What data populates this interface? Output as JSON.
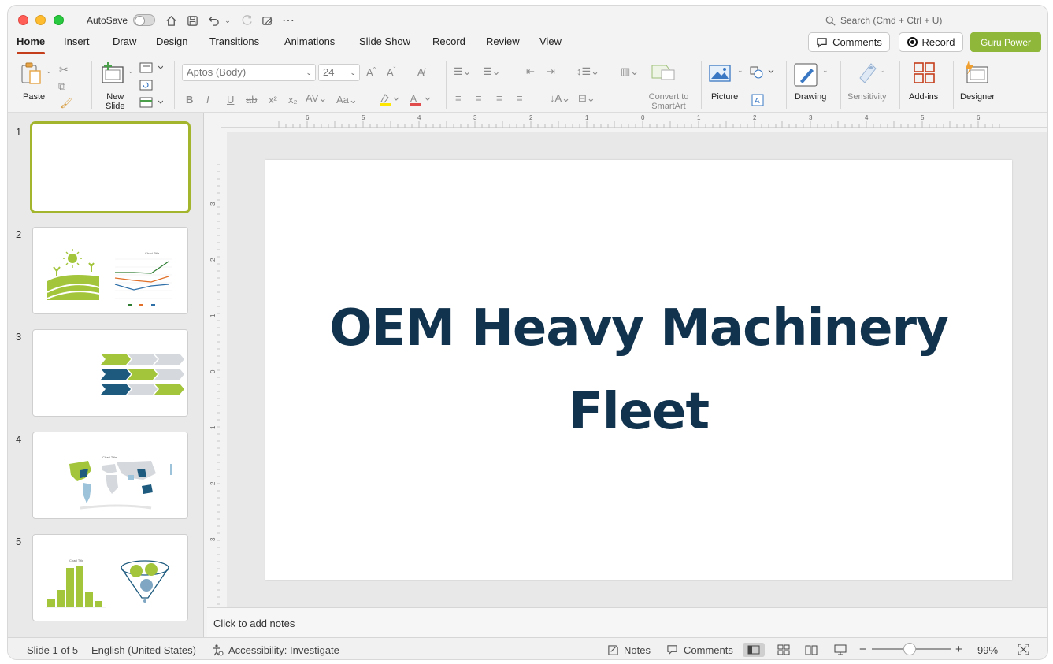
{
  "titlebar": {
    "autosave_label": "AutoSave",
    "search_placeholder": "Search (Cmd + Ctrl + U)"
  },
  "tabs": [
    "Home",
    "Insert",
    "Draw",
    "Design",
    "Transitions",
    "Animations",
    "Slide Show",
    "Record",
    "Review",
    "View"
  ],
  "actions": {
    "comments": "Comments",
    "record": "Record",
    "guru": "Guru Power"
  },
  "ribbon": {
    "paste": "Paste",
    "new_slide_1": "New",
    "new_slide_2": "Slide",
    "font_name": "Aptos (Body)",
    "font_size": "24",
    "convert_1": "Convert to",
    "convert_2": "SmartArt",
    "picture": "Picture",
    "drawing": "Drawing",
    "sensitivity": "Sensitivity",
    "addins": "Add-ins",
    "designer": "Designer"
  },
  "slides": [
    "1",
    "2",
    "3",
    "4",
    "5"
  ],
  "thumb_chart_title": "Chart Title",
  "slide_title_line1": "OEM Heavy Machinery",
  "slide_title_line2": "Fleet",
  "notes_placeholder": "Click to add notes",
  "status": {
    "slide_count": "Slide 1 of 5",
    "language": "English (United States)",
    "accessibility": "Accessibility: Investigate",
    "notes": "Notes",
    "comments": "Comments",
    "zoom": "99%"
  },
  "ruler_h_labels": [
    "6",
    "5",
    "4",
    "3",
    "2",
    "1",
    "0",
    "1",
    "2",
    "3",
    "4",
    "5",
    "6"
  ],
  "ruler_v_labels": [
    "3",
    "2",
    "1",
    "0",
    "1",
    "2",
    "3"
  ],
  "colors": {
    "accent": "#c43e1c",
    "guru": "#8fb83a",
    "title": "#12334d",
    "thumb_green": "#a3c53c",
    "thumb_navy": "#1d5a7e"
  }
}
